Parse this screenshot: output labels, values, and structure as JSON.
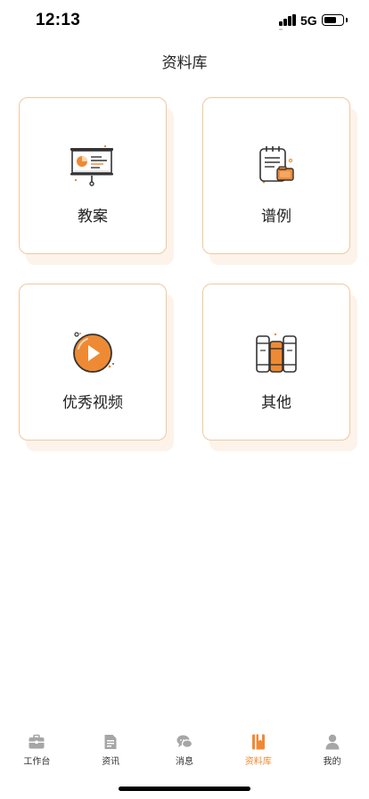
{
  "status_bar": {
    "time": "12:13",
    "network": "5G"
  },
  "header": {
    "title": "资料库"
  },
  "categories": [
    {
      "label": "教案",
      "icon": "presentation-board-icon"
    },
    {
      "label": "谱例",
      "icon": "notepad-folder-icon"
    },
    {
      "label": "优秀视频",
      "icon": "play-circle-icon"
    },
    {
      "label": "其他",
      "icon": "books-icon"
    }
  ],
  "tab_bar": {
    "items": [
      {
        "label": "工作台",
        "icon": "briefcase-icon",
        "active": false
      },
      {
        "label": "资讯",
        "icon": "document-icon",
        "active": false
      },
      {
        "label": "消息",
        "icon": "chat-bubbles-icon",
        "active": false
      },
      {
        "label": "资料库",
        "icon": "library-book-icon",
        "active": true
      },
      {
        "label": "我的",
        "icon": "person-icon",
        "active": false
      }
    ]
  },
  "colors": {
    "accent": "#ef8a34",
    "card_border": "#efc99e",
    "card_shadow": "#fdf3ea",
    "inactive_tab_icon": "#a6a6a6"
  }
}
